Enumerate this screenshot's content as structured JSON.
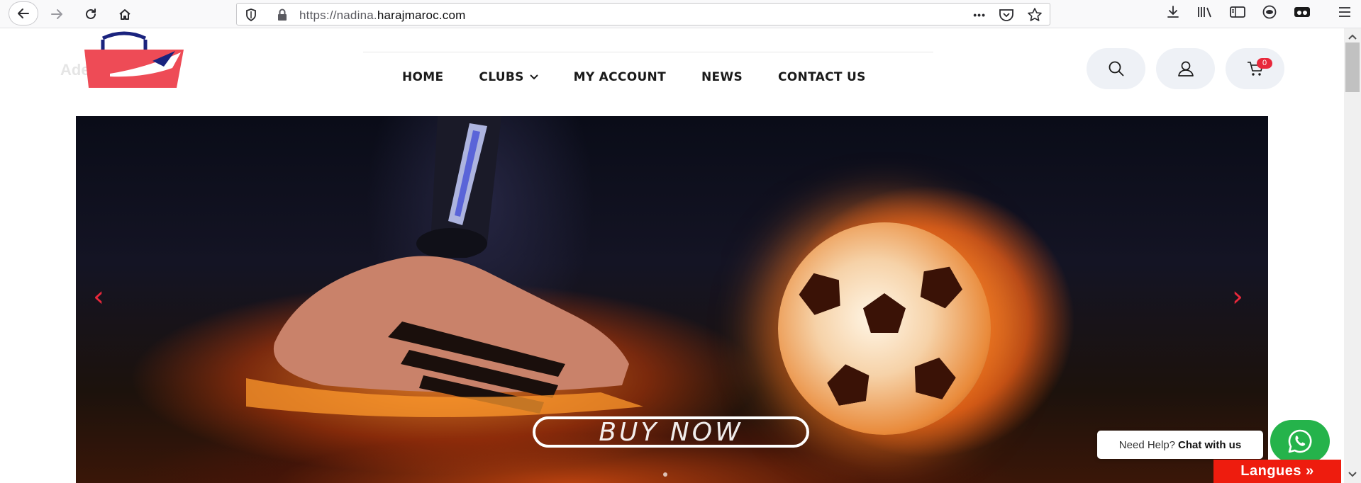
{
  "browser": {
    "url_prefix": "https://nadina.",
    "url_domain": "harajmaroc",
    "url_suffix": ".com",
    "more_label": "•••"
  },
  "logo": {
    "faded_text": "Ade"
  },
  "nav": {
    "items": [
      {
        "label": "HOME"
      },
      {
        "label": "CLUBS"
      },
      {
        "label": "MY ACCOUNT"
      },
      {
        "label": "NEWS"
      },
      {
        "label": "CONTACT US"
      }
    ]
  },
  "header_icons": {
    "cart_count": "0"
  },
  "hero": {
    "prev_arrow": "‹",
    "next_arrow": "›",
    "button_label": "BUY NOW"
  },
  "chat": {
    "prefix": "Need Help?",
    "cta": "Chat with us"
  },
  "langues_label": "Langues »",
  "colors": {
    "accent_red": "#e8283b",
    "whatsapp_green": "#25b34b",
    "langues_red": "#ee1c0e"
  }
}
